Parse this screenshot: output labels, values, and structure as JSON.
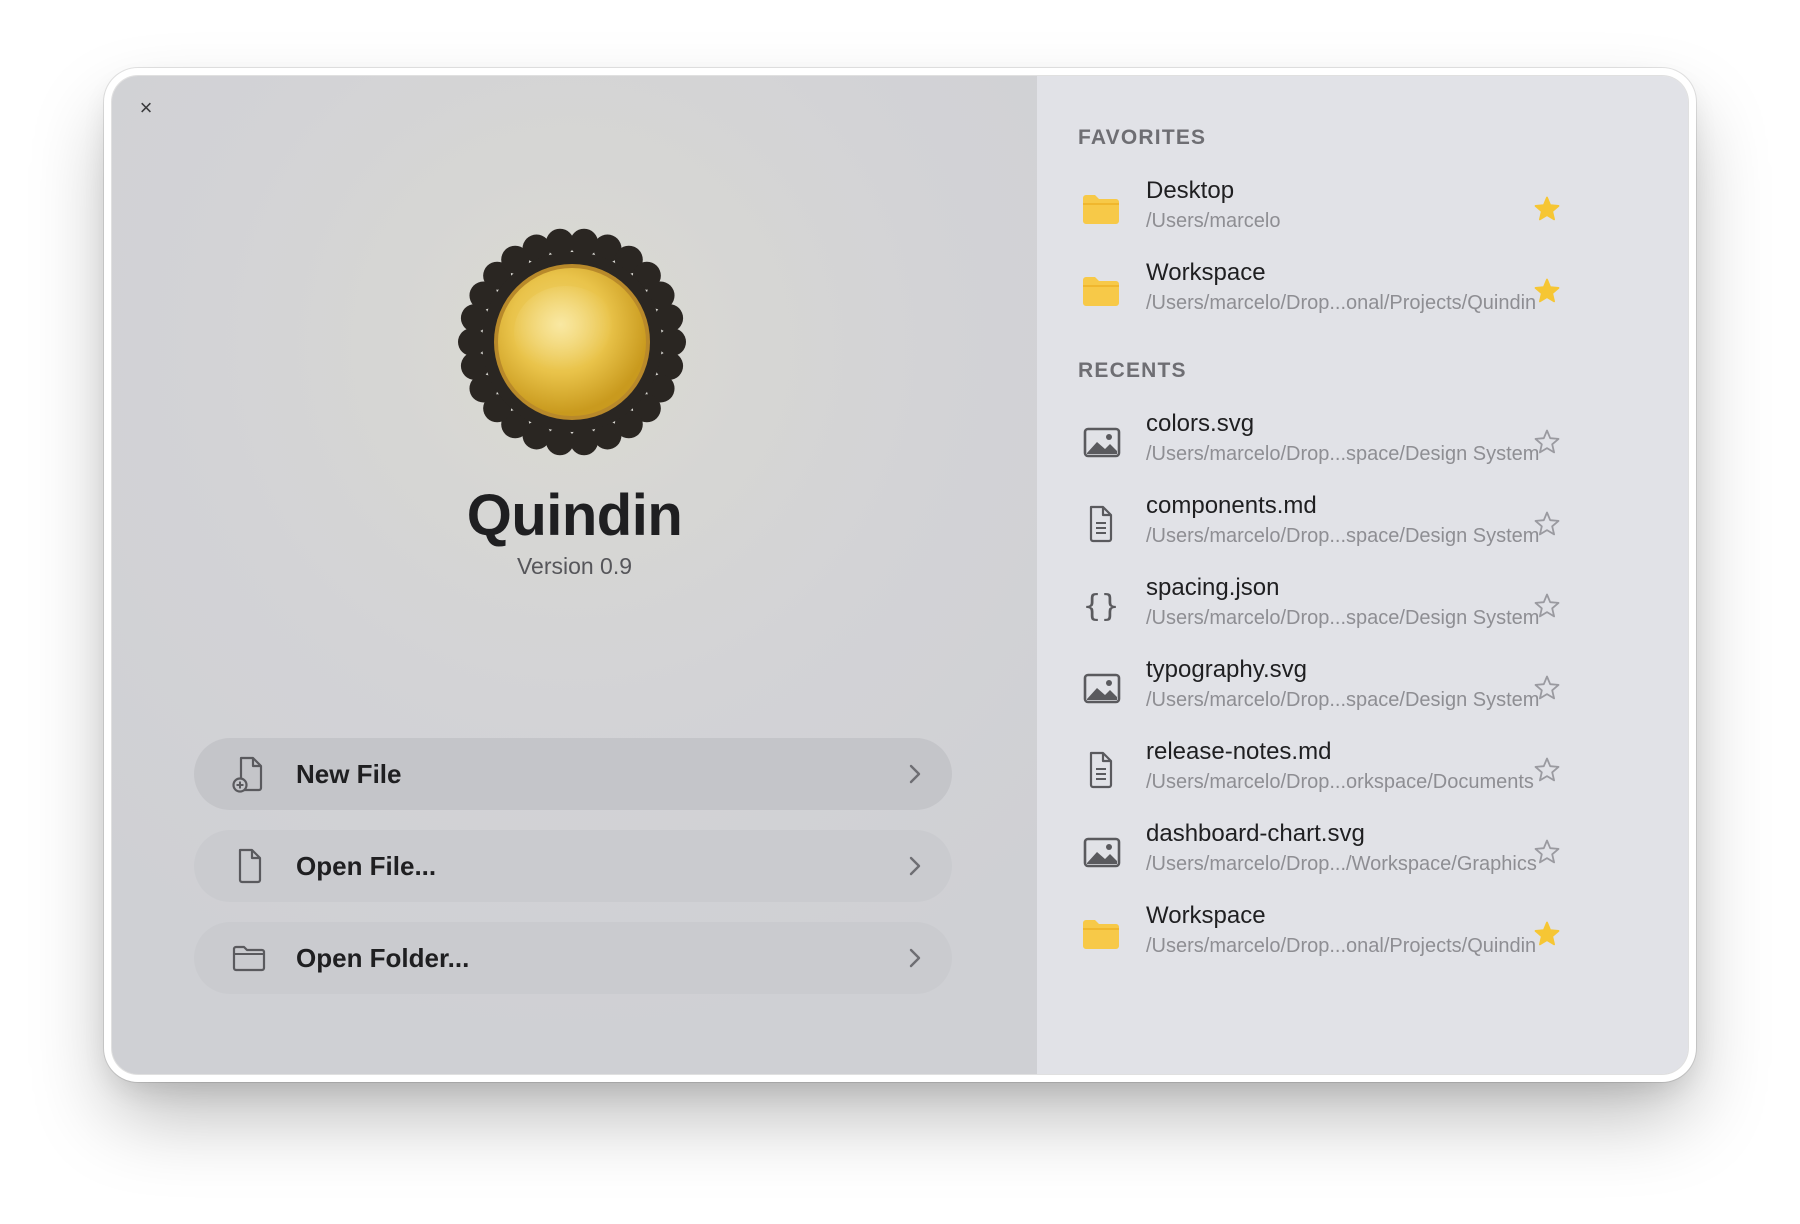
{
  "app": {
    "name": "Quindin",
    "version": "Version 0.9",
    "close_label": "×"
  },
  "actions": [
    {
      "label": "New File",
      "icon": "new-file-icon"
    },
    {
      "label": "Open File...",
      "icon": "file-icon"
    },
    {
      "label": "Open Folder...",
      "icon": "folder-icon"
    }
  ],
  "favorites": {
    "title": "FAVORITES",
    "items": [
      {
        "name": "Desktop",
        "path": "/Users/marcelo",
        "icon": "folder-icon",
        "starred": true
      },
      {
        "name": "Workspace",
        "path": "/Users/marcelo/Drop...onal/Projects/Quindin",
        "icon": "folder-icon",
        "starred": true
      }
    ]
  },
  "recents": {
    "title": "RECENTS",
    "items": [
      {
        "name": "colors.svg",
        "path": "/Users/marcelo/Drop...space/Design System",
        "icon": "image-icon",
        "starred": false
      },
      {
        "name": "components.md",
        "path": "/Users/marcelo/Drop...space/Design System",
        "icon": "document-icon",
        "starred": false
      },
      {
        "name": "spacing.json",
        "path": "/Users/marcelo/Drop...space/Design System",
        "icon": "braces-icon",
        "starred": false
      },
      {
        "name": "typography.svg",
        "path": "/Users/marcelo/Drop...space/Design System",
        "icon": "image-icon",
        "starred": false
      },
      {
        "name": "release-notes.md",
        "path": "/Users/marcelo/Drop...orkspace/Documents",
        "icon": "document-icon",
        "starred": false
      },
      {
        "name": "dashboard-chart.svg",
        "path": "/Users/marcelo/Drop.../Workspace/Graphics",
        "icon": "image-icon",
        "starred": false
      },
      {
        "name": "Workspace",
        "path": "/Users/marcelo/Drop...onal/Projects/Quindin",
        "icon": "folder-icon",
        "starred": true
      }
    ]
  },
  "colors": {
    "star_active": "#f6c634",
    "folder": "#f7c948",
    "star_inactive": "#9a9aa0"
  }
}
